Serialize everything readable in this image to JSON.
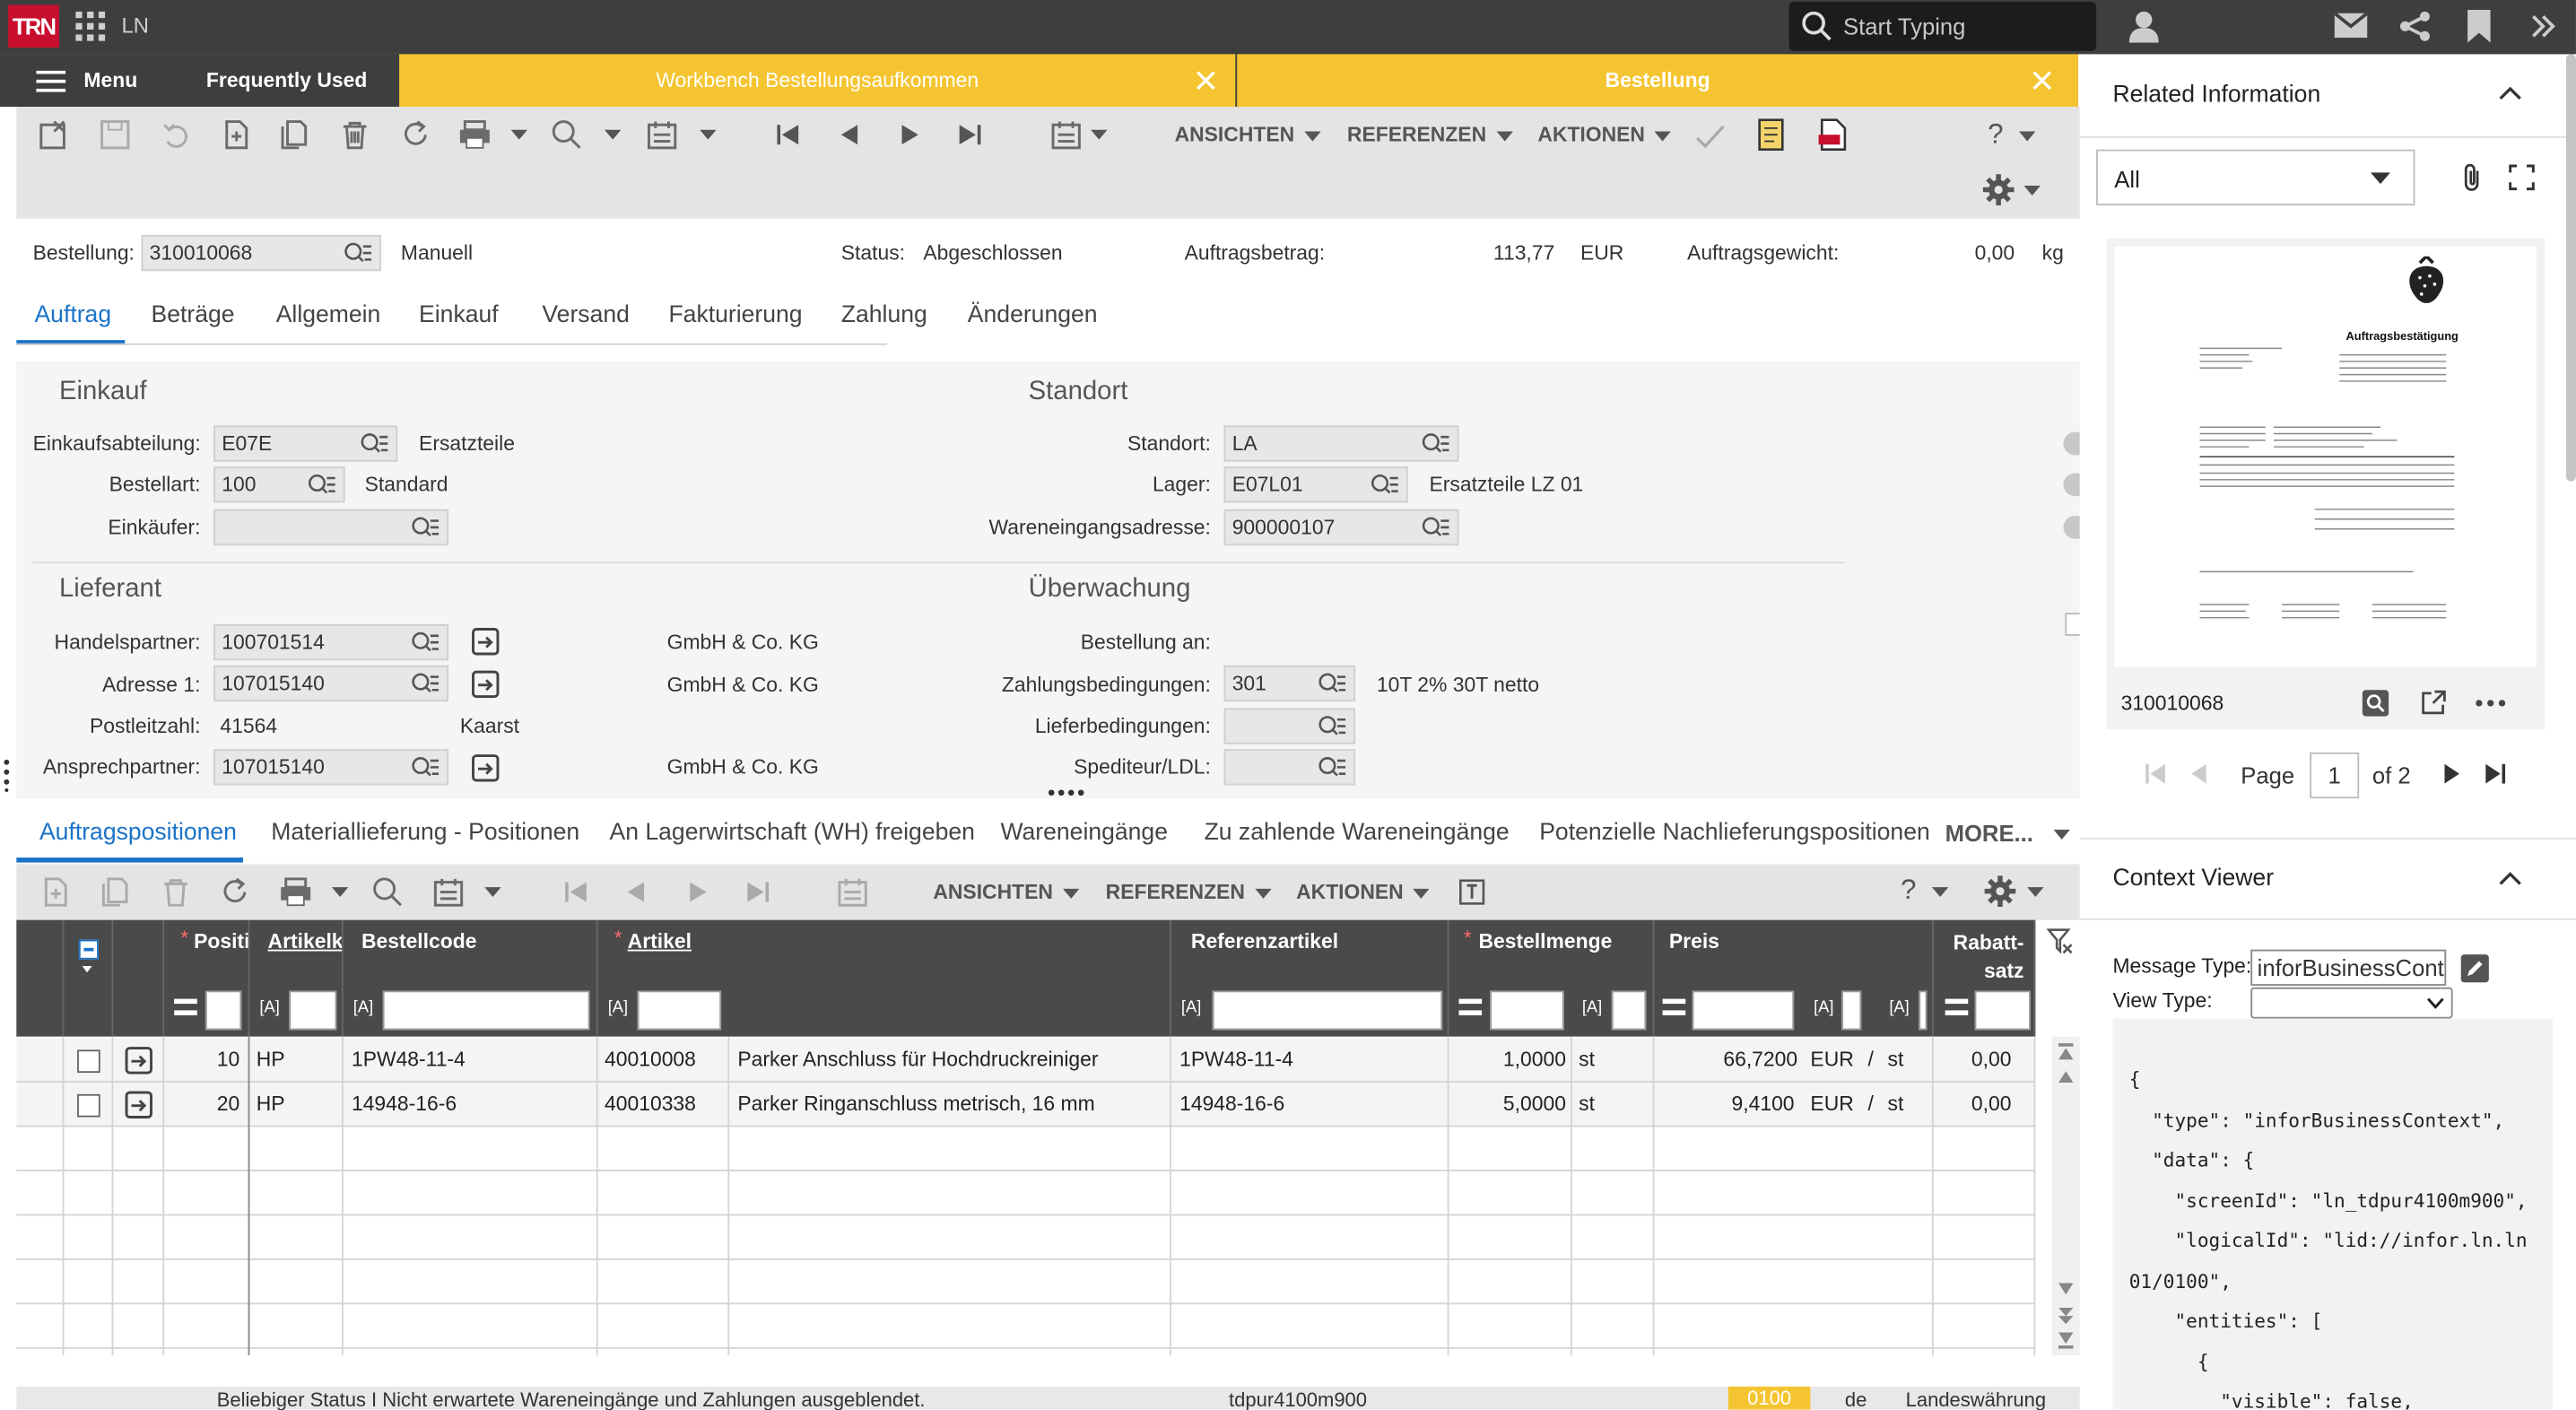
{
  "topbar": {
    "logo": "TRN",
    "app": "LN",
    "search_placeholder": "Start Typing"
  },
  "tabs": {
    "menu": "Menu",
    "frequent": "Frequently Used",
    "workbench": "Workbench Bestellungsaufkommen",
    "order": "Bestellung"
  },
  "toolbar": {
    "views": "ANSICHTEN",
    "refs": "REFERENZEN",
    "actions": "AKTIONEN",
    "help": "?"
  },
  "header": {
    "order_label": "Bestellung:",
    "order_value": "310010068",
    "mode": "Manuell",
    "status_label": "Status:",
    "status_value": "Abgeschlossen",
    "amount_label": "Auftragsbetrag:",
    "amount_value": "113,77",
    "currency": "EUR",
    "weight_label": "Auftragsgewicht:",
    "weight_value": "0,00",
    "weight_unit": "kg"
  },
  "subtabs": [
    "Auftrag",
    "Beträge",
    "Allgemein",
    "Einkauf",
    "Versand",
    "Fakturierung",
    "Zahlung",
    "Änderungen"
  ],
  "einkauf": {
    "title": "Einkauf",
    "dept_label": "Einkaufsabteilung:",
    "dept_value": "E07E",
    "dept_desc": "Ersatzteile",
    "type_label": "Bestellart:",
    "type_value": "100",
    "type_desc": "Standard",
    "buyer_label": "Einkäufer:",
    "buyer_value": ""
  },
  "standort": {
    "title": "Standort",
    "site_label": "Standort:",
    "site_value": "LA",
    "wh_label": "Lager:",
    "wh_value": "E07L01",
    "wh_desc": "Ersatzteile LZ 01",
    "addr_label": "Wareneingangsadresse:",
    "addr_value": "900000107"
  },
  "lieferant": {
    "title": "Lieferant",
    "partner_label": "Handelspartner:",
    "partner_value": "100701514",
    "partner_desc": "GmbH & Co. KG",
    "addr_label": "Adresse 1:",
    "addr_value": "107015140",
    "addr_desc": "GmbH & Co. KG",
    "zip_label": "Postleitzahl:",
    "zip_value": "41564",
    "city": "Kaarst",
    "contact_label": "Ansprechpartner:",
    "contact_value": "107015140",
    "contact_desc": "GmbH & Co. KG"
  },
  "ueberwachung": {
    "title": "Überwachung",
    "order_to_label": "Bestellung an:",
    "terms_label": "Zahlungsbedingungen:",
    "terms_value": "301",
    "terms_desc": "10T 2% 30T netto",
    "delivery_label": "Lieferbedingungen:",
    "forwarder_label": "Spediteur/LDL:"
  },
  "lowertabs": [
    "Auftragspositionen",
    "Materiallieferung - Positionen",
    "An Lagerwirtschaft (WH) freigeben",
    "Wareneingänge",
    "Zu zahlende Wareneingänge",
    "Potenzielle Nachlieferungspositionen"
  ],
  "more": "MORE...",
  "grid": {
    "headers": {
      "pos": "Positi",
      "artikelk": "Artikelk",
      "bestellcode": "Bestellcode",
      "artikel": "Artikel",
      "ref": "Referenzartikel",
      "menge": "Bestellmenge",
      "preis": "Preis",
      "rabatt1": "Rabatt-",
      "rabatt2": "satz"
    },
    "filter_tag": "[A]",
    "rows": [
      {
        "pos": "10",
        "artgroup": "HP",
        "code": "1PW48-11-4",
        "artikel": "40010008",
        "desc": "Parker Anschluss für Hochdruckreiniger",
        "ref": "1PW48-11-4",
        "qty": "1,0000",
        "unit": "st",
        "price": "66,7200",
        "cur": "EUR",
        "sep": "/",
        "punit": "st",
        "disc": "0,00"
      },
      {
        "pos": "20",
        "artgroup": "HP",
        "code": "14948-16-6",
        "artikel": "40010338",
        "desc": "Parker Ringanschluss metrisch, 16 mm",
        "ref": "14948-16-6",
        "qty": "5,0000",
        "unit": "st",
        "price": "9,4100",
        "cur": "EUR",
        "sep": "/",
        "punit": "st",
        "disc": "0,00"
      }
    ]
  },
  "statusbar": {
    "msg": "Beliebiger Status I Nicht erwartete Wareneingänge und Zahlungen ausgeblendet.",
    "session": "tdpur4100m900",
    "company": "0100",
    "lang": "de",
    "currency": "Landeswährung"
  },
  "related": {
    "title": "Related Information",
    "filter": "All",
    "doc_title": "Auftragsbestätigung",
    "doc_name": "310010068",
    "page_label": "Page",
    "page_value": "1",
    "page_of": "of 2"
  },
  "context": {
    "title": "Context Viewer",
    "msg_type_label": "Message Type:",
    "msg_type_value": "inforBusinessConte",
    "view_type_label": "View Type:",
    "json_lines": [
      "{",
      "  \"type\": \"inforBusinessContext\",",
      "  \"data\": {",
      "    \"screenId\": \"ln_tdpur4100m900\",",
      "    \"logicalId\": \"lid://infor.ln.ln",
      "01/0100\",",
      "    \"entities\": [",
      "      {",
      "        \"visible\": false,"
    ]
  },
  "colors": {
    "accent": "#1a73c8",
    "tab_yellow": "#f5c531",
    "logo": "#c8102e",
    "company_badge": "#f5c531"
  }
}
